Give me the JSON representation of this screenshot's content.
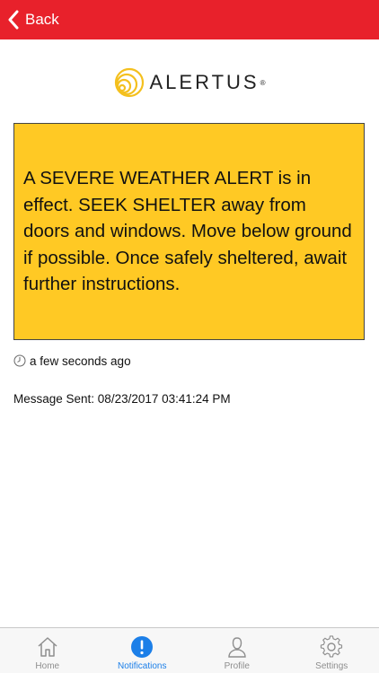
{
  "header": {
    "back_label": "Back"
  },
  "logo": {
    "brand": "ALERTUS",
    "reg_mark": "®"
  },
  "alert": {
    "message": "A SEVERE WEATHER ALERT is in effect. SEEK SHELTER away from doors and windows. Move below ground if possible. Once safely sheltered, await further instructions.",
    "background_color": "#ffc924"
  },
  "meta": {
    "relative_time": "a few seconds ago",
    "message_sent": "Message Sent: 08/23/2017 03:41:24 PM"
  },
  "tabbar": {
    "active": "Notifications",
    "accent_color": "#1c7fe8",
    "items": [
      {
        "label": "Home",
        "icon": "home-icon"
      },
      {
        "label": "Notifications",
        "icon": "alert-circle-icon"
      },
      {
        "label": "Profile",
        "icon": "person-icon"
      },
      {
        "label": "Settings",
        "icon": "gear-icon"
      }
    ]
  },
  "colors": {
    "header_bg": "#e8212b"
  }
}
